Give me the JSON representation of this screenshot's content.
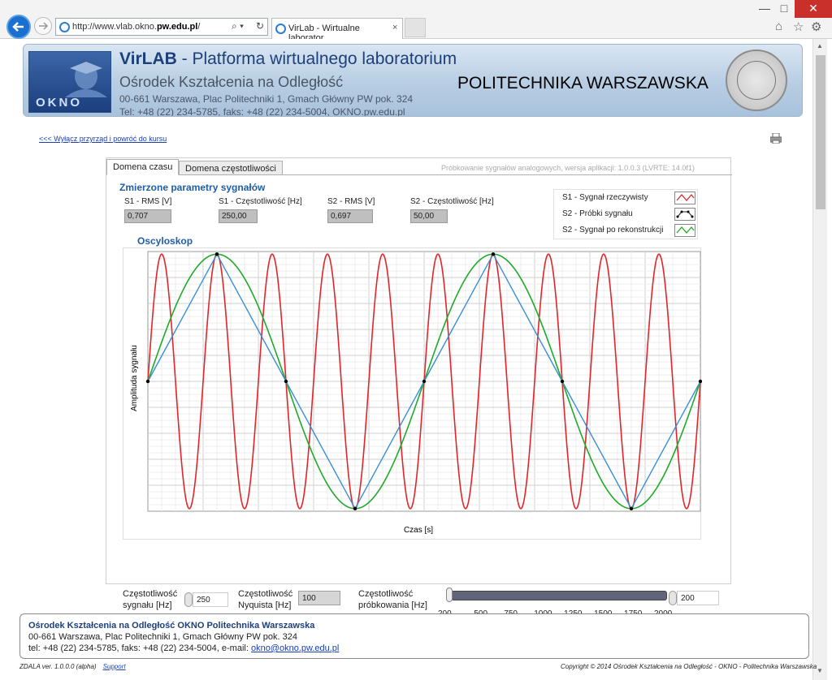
{
  "browser": {
    "url_prefix": "http://www.vlab.okno.",
    "url_domain": "pw.edu.pl",
    "url_suffix": "/",
    "tab_title": "VirLab - Wirtualne laborator...",
    "tab_close": "×",
    "min_glyph": "—",
    "max_glyph": "□",
    "close_glyph": "✕",
    "search_glyph": "⌕ ▾",
    "refresh_glyph": "↻",
    "home_glyph": "⌂",
    "fav_glyph": "☆",
    "settings_glyph": "⚙"
  },
  "banner": {
    "title_bold": "VirLAB",
    "title_rest": " - Platforma wirtualnego laboratorium",
    "org": "Ośrodek Kształcenia na Odległość",
    "address": "00-661 Warszawa, Plac Politechniki 1, Gmach Główny PW pok. 324",
    "contact": "Tel: +48 (22) 234-5785,  faks: +48 (22) 234-5004,   OKNO.pw.edu.pl",
    "logo_text": "OKNO",
    "university": "POLITECHNIKA WARSZAWSKA"
  },
  "nav": {
    "back_link": "<<< Wyłącz przyrząd i powróć do kursu"
  },
  "app": {
    "tabs": [
      "Domena czasu",
      "Domena częstotliwości"
    ],
    "version": "Próbkowanie sygnałów analogowych, wersja aplikacji:  1.0.0.3  (LVRTE: 14.0f1)",
    "params_title": "Zmierzone parametry sygnałów",
    "params": [
      {
        "label": "S1 - RMS [V]",
        "value": "0,707"
      },
      {
        "label": "S1 - Częstotliwość [Hz]",
        "value": "250,00"
      },
      {
        "label": "S2 - RMS [V]",
        "value": "0,697"
      },
      {
        "label": "S2 - Częstotliwość [Hz]",
        "value": "50,00"
      }
    ],
    "legend": [
      {
        "label": "S1 - Sygnał rzeczywisty",
        "color": "#e0262a"
      },
      {
        "label": "S2 - Próbki sygnału",
        "color": "#000000"
      },
      {
        "label": "S2 - Sygnał po rekonstrukcji",
        "color": "#1faa2a"
      }
    ],
    "scope_title": "Oscyloskop",
    "ylabel": "Amplituda sygnału",
    "xlabel": "Czas [s]",
    "controls": {
      "signal_freq_label_1": "Częstotliwość",
      "signal_freq_label_2": "sygnału [Hz]",
      "signal_freq_value": "250",
      "nyquist_label_1": "Częstotliwość",
      "nyquist_label_2": "Nyquista  [Hz]",
      "nyquist_value": "100",
      "sampling_label_1": "Częstotliwość",
      "sampling_label_2": "próbkowania  [Hz]",
      "sampling_value": "200",
      "slider_ticks": [
        "200",
        "500",
        "750",
        "1000",
        "1250",
        "1500",
        "1750",
        "2000"
      ],
      "slider_min": 200,
      "slider_max": 2000,
      "slider_value": 200
    }
  },
  "chart_data": {
    "type": "line",
    "xlabel": "Czas [s]",
    "ylabel": "Amplituda sygnału",
    "series": [
      {
        "name": "S1 - Sygnał rzeczywisty",
        "kind": "sine",
        "frequency_hz": 250,
        "cycles": 10.0,
        "color": "#e0262a"
      },
      {
        "name": "S2 - Próbki sygnału",
        "kind": "samples",
        "count": 9,
        "values": [
          0,
          1,
          0,
          -1,
          0,
          1,
          0,
          -1,
          0
        ],
        "color": "#000000",
        "line_color": "#3b8fd6"
      },
      {
        "name": "S2 - Sygnał po rekonstrukcji",
        "kind": "sine",
        "frequency_hz": 50,
        "cycles": 2.0,
        "color": "#1faa2a"
      }
    ],
    "ylim": [
      -1,
      1
    ],
    "grid": true
  },
  "footer": {
    "org": "Ośrodek Kształcenia na Odległość OKNO Politechnika Warszawska",
    "address": "00-661 Warszawa, Plac Politechniki 1, Gmach Główny PW pok. 324",
    "contact_prefix": "tel: +48 (22) 234-5785, faks: +48 (22) 234-5004, e-mail: ",
    "email": "okno@okno.pw.edu.pl",
    "version": "ZDALA ver. 1.0.0.0 (alpha)",
    "support": "Support",
    "copyright": "Copyright © 2014 Ośrodek Kształcenia na Odległość - OKNO - Politechnika Warszawska"
  }
}
